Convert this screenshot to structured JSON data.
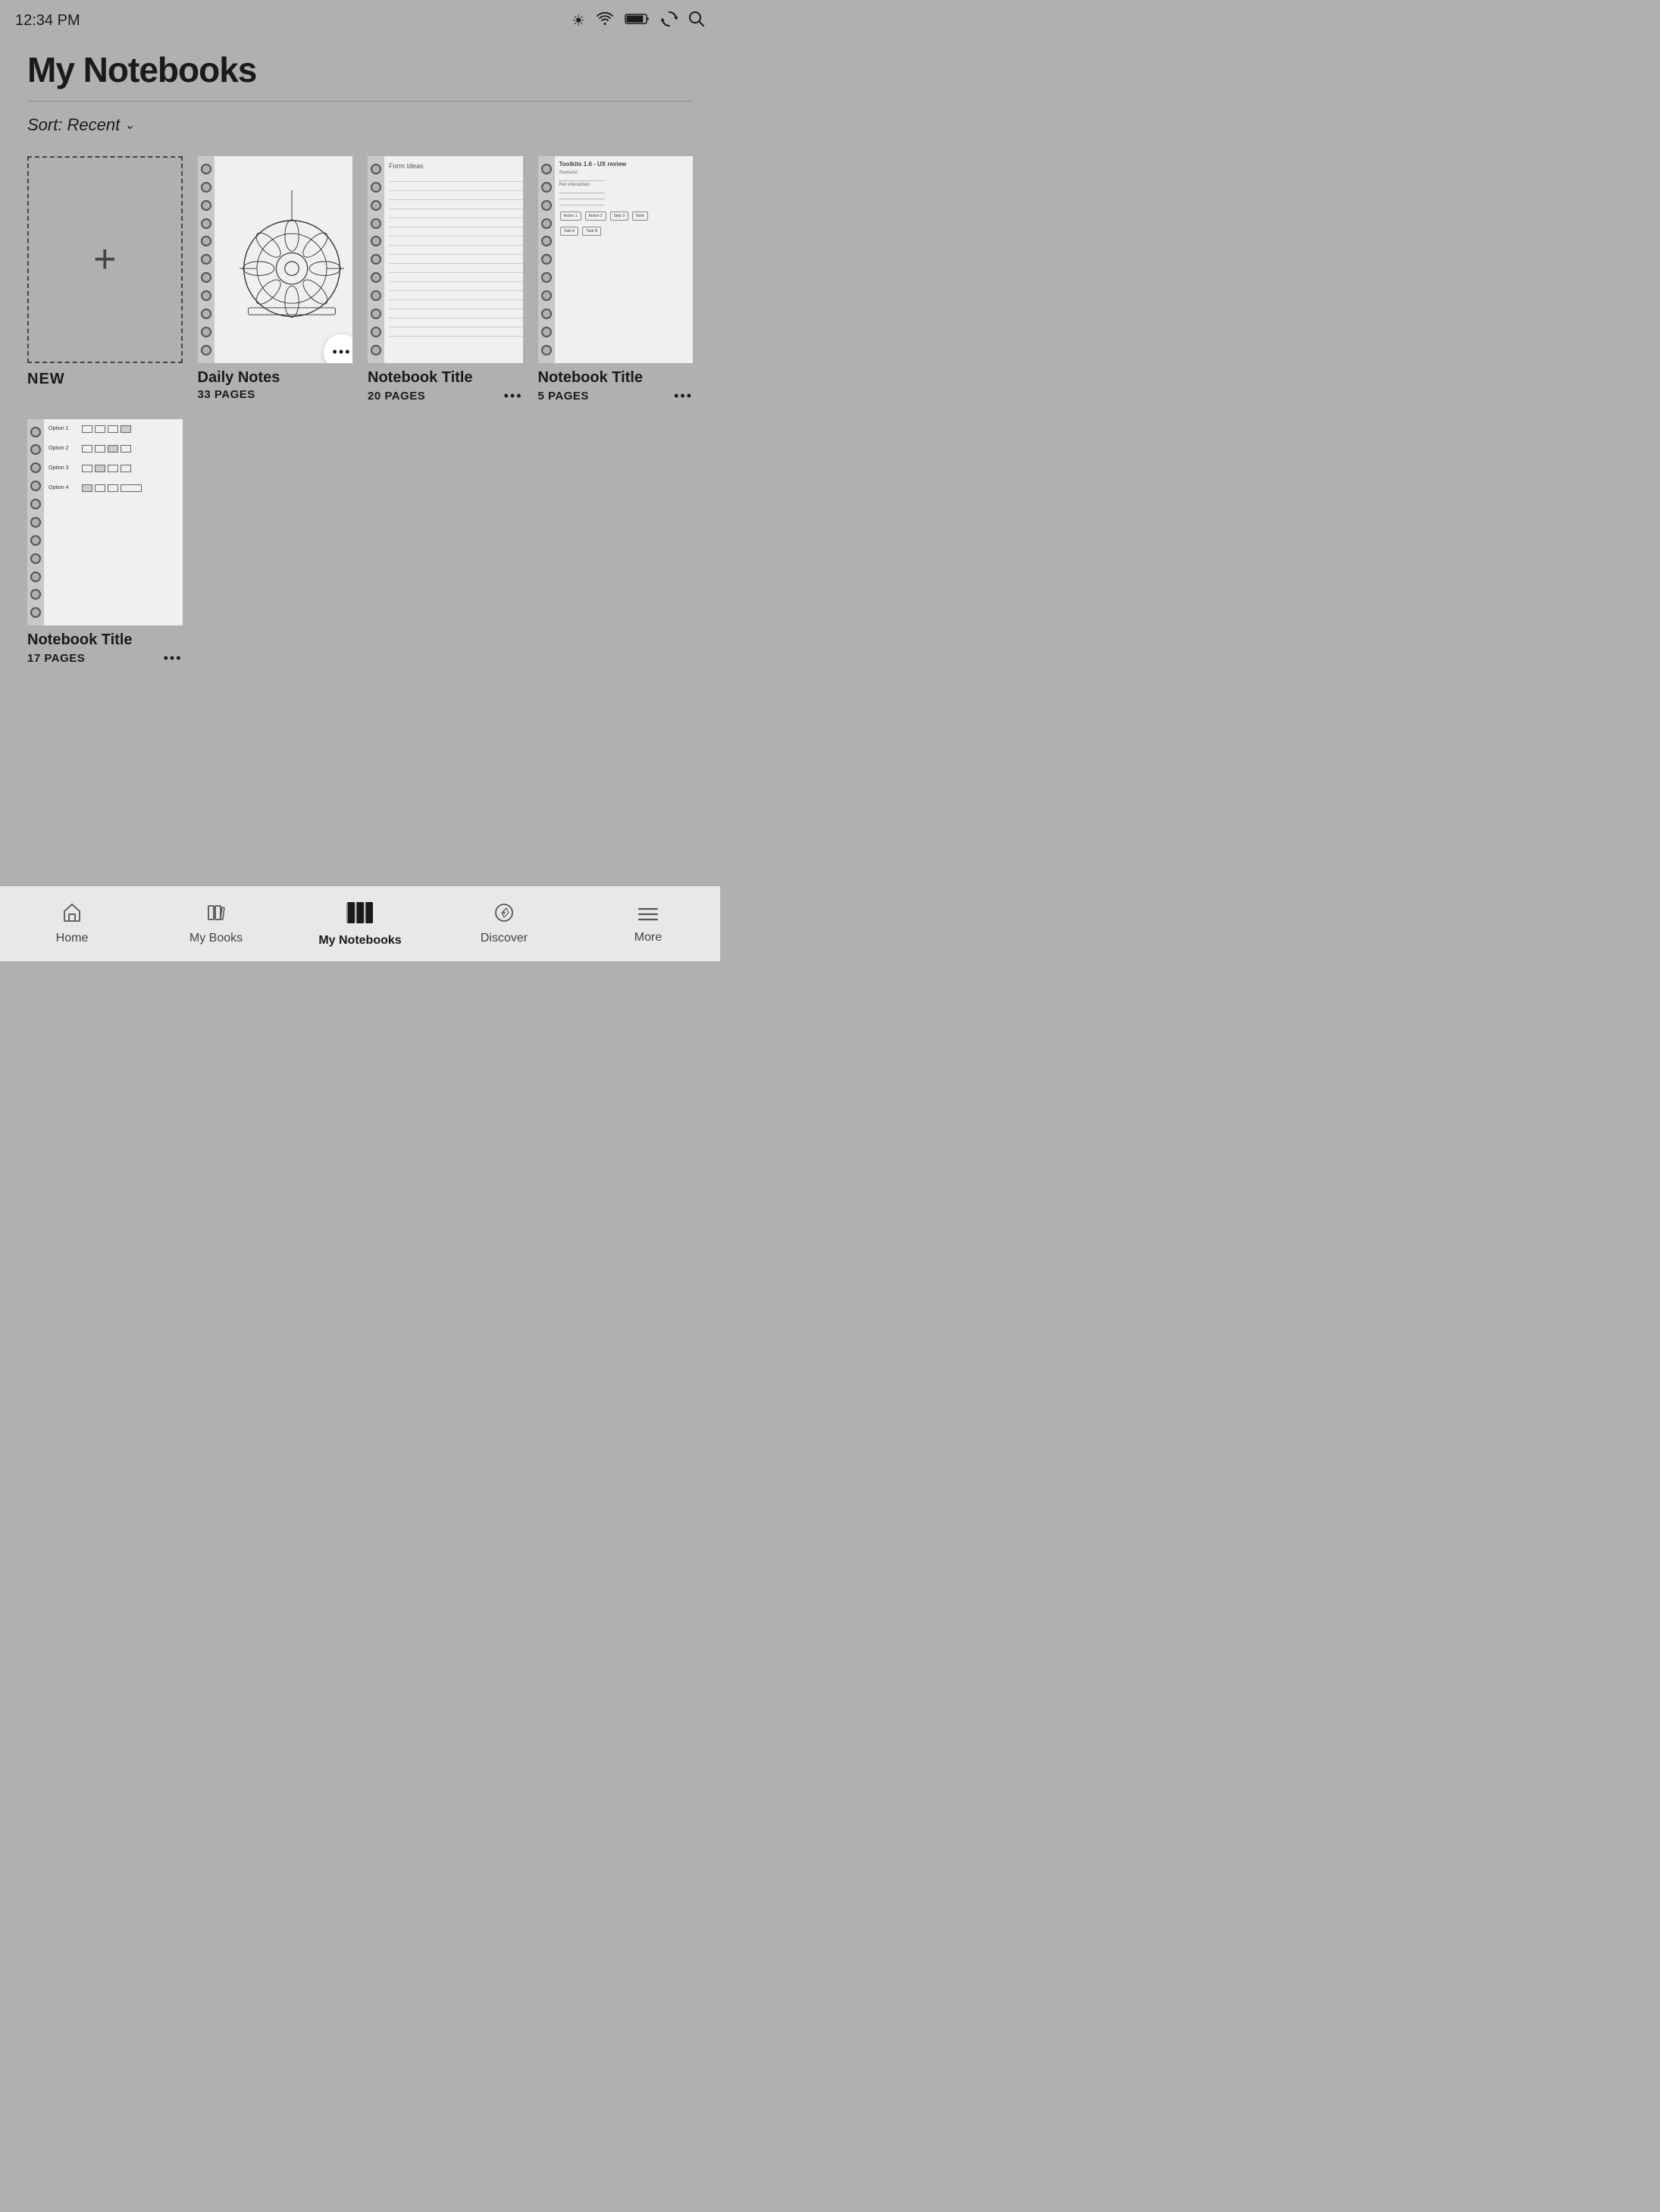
{
  "statusBar": {
    "time": "12:34 PM"
  },
  "header": {
    "title": "My Notebooks",
    "sort": {
      "label": "Sort:",
      "value": "Recent"
    }
  },
  "notebooks": [
    {
      "id": "new",
      "type": "new",
      "label": "NEW"
    },
    {
      "id": "daily-notes",
      "type": "sketch",
      "title": "Daily Notes",
      "pages": "33 PAGES",
      "hasActiveMenu": true
    },
    {
      "id": "notebook-2",
      "type": "lined",
      "title": "Notebook Title",
      "pages": "20 PAGES"
    },
    {
      "id": "notebook-3",
      "type": "toolkits",
      "title": "Notebook Title",
      "pages": "5 PAGES"
    },
    {
      "id": "notebook-4",
      "type": "options",
      "title": "Notebook Title",
      "pages": "17 PAGES"
    }
  ],
  "nav": {
    "items": [
      {
        "id": "home",
        "label": "Home",
        "icon": "home"
      },
      {
        "id": "my-books",
        "label": "My Books",
        "icon": "books"
      },
      {
        "id": "my-notebooks",
        "label": "My Notebooks",
        "icon": "notebooks",
        "active": true
      },
      {
        "id": "discover",
        "label": "Discover",
        "icon": "compass"
      },
      {
        "id": "more",
        "label": "More",
        "icon": "menu"
      }
    ]
  }
}
